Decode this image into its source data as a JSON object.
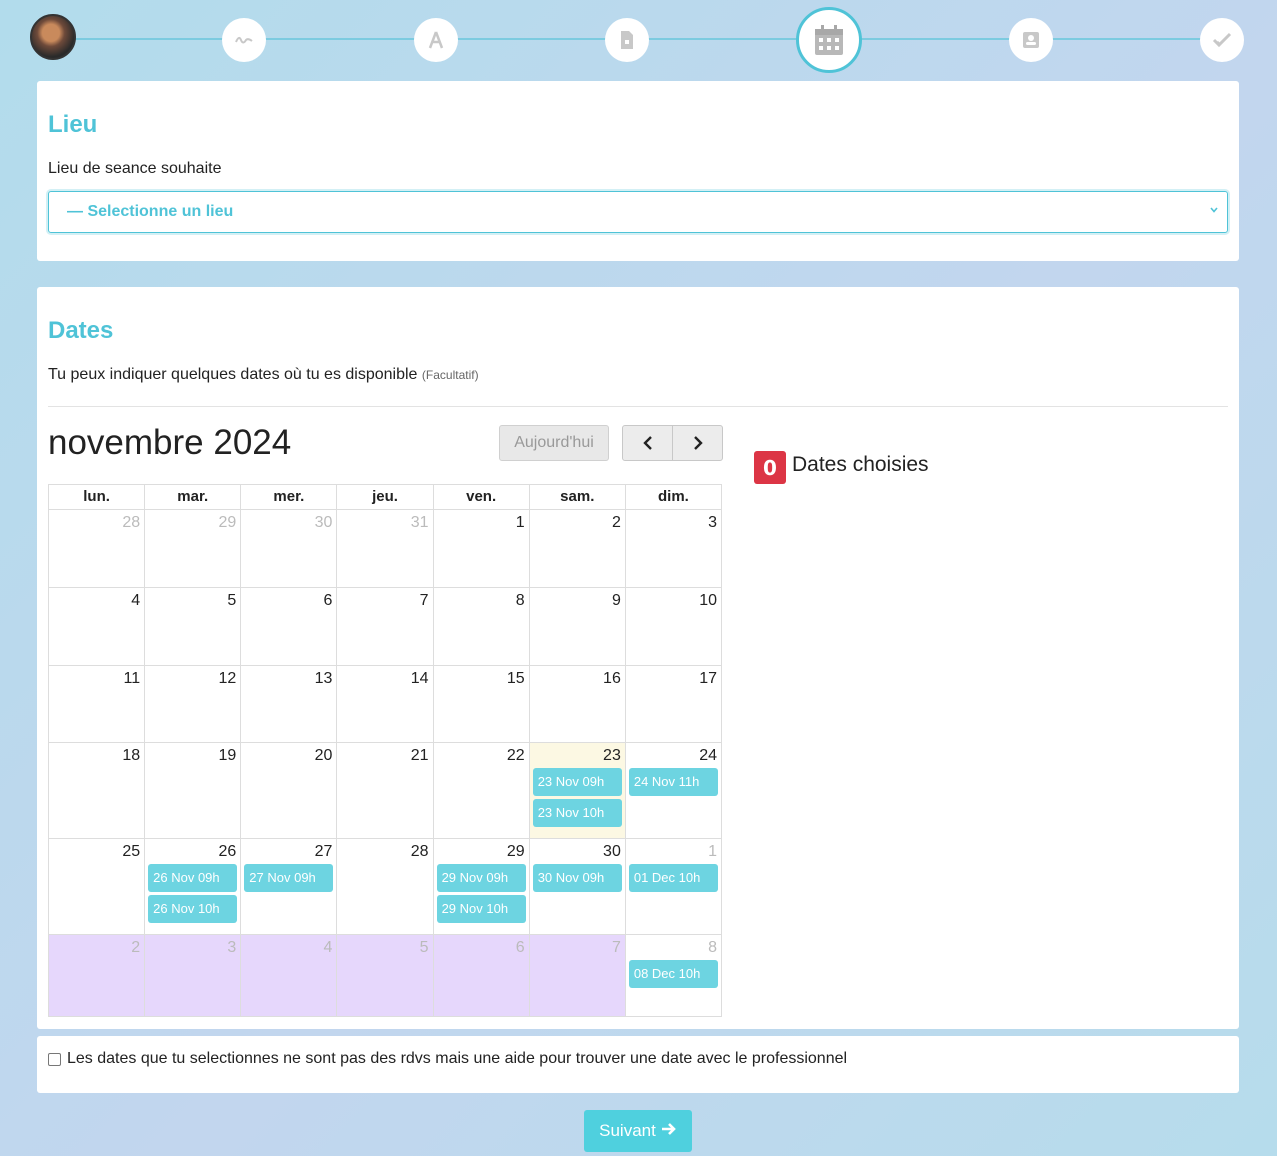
{
  "stepper": {
    "steps": [
      {
        "icon": "avatar"
      },
      {
        "icon": "signature-icon"
      },
      {
        "icon": "compass-icon"
      },
      {
        "icon": "document-icon"
      },
      {
        "icon": "calendar-icon",
        "active": true
      },
      {
        "icon": "contact-card-icon"
      },
      {
        "icon": "check-icon"
      }
    ]
  },
  "lieu": {
    "title": "Lieu",
    "label": "Lieu de seance souhaite",
    "select_value": "— Selectionne un lieu"
  },
  "dates": {
    "title": "Dates",
    "subtitle": "Tu peux indiquer quelques dates où tu es disponible",
    "optional": "(Facultatif)",
    "month_title": "novembre 2024",
    "today_button": "Aujourd'hui",
    "prev_label": "‹",
    "next_label": "›",
    "count": "0",
    "count_label": "Dates choisies",
    "weekdays": [
      "lun.",
      "mar.",
      "mer.",
      "jeu.",
      "ven.",
      "sam.",
      "dim."
    ],
    "weeks": [
      [
        {
          "d": "28",
          "o": true
        },
        {
          "d": "29",
          "o": true
        },
        {
          "d": "30",
          "o": true
        },
        {
          "d": "31",
          "o": true
        },
        {
          "d": "1"
        },
        {
          "d": "2"
        },
        {
          "d": "3"
        }
      ],
      [
        {
          "d": "4"
        },
        {
          "d": "5"
        },
        {
          "d": "6"
        },
        {
          "d": "7"
        },
        {
          "d": "8"
        },
        {
          "d": "9"
        },
        {
          "d": "10"
        }
      ],
      [
        {
          "d": "11"
        },
        {
          "d": "12"
        },
        {
          "d": "13"
        },
        {
          "d": "14"
        },
        {
          "d": "15"
        },
        {
          "d": "16"
        },
        {
          "d": "17"
        }
      ],
      [
        {
          "d": "18"
        },
        {
          "d": "19"
        },
        {
          "d": "20"
        },
        {
          "d": "21"
        },
        {
          "d": "22"
        },
        {
          "d": "23",
          "today": true,
          "events": [
            "23 Nov 09h",
            "23 Nov 10h"
          ]
        },
        {
          "d": "24",
          "events": [
            "24 Nov 11h"
          ]
        }
      ],
      [
        {
          "d": "25"
        },
        {
          "d": "26",
          "events": [
            "26 Nov 09h",
            "26 Nov 10h"
          ]
        },
        {
          "d": "27",
          "events": [
            "27 Nov 09h"
          ]
        },
        {
          "d": "28"
        },
        {
          "d": "29",
          "events": [
            "29 Nov 09h",
            "29 Nov 10h"
          ]
        },
        {
          "d": "30",
          "events": [
            "30 Nov 09h"
          ]
        },
        {
          "d": "1",
          "o": true,
          "events": [
            "01 Dec 10h"
          ]
        }
      ],
      [
        {
          "d": "2",
          "o": true,
          "purple": true
        },
        {
          "d": "3",
          "o": true,
          "purple": true
        },
        {
          "d": "4",
          "o": true,
          "purple": true
        },
        {
          "d": "5",
          "o": true,
          "purple": true
        },
        {
          "d": "6",
          "o": true,
          "purple": true
        },
        {
          "d": "7",
          "o": true,
          "purple": true
        },
        {
          "d": "8",
          "o": true,
          "events": [
            "08 Dec 10h"
          ]
        }
      ]
    ]
  },
  "notice": {
    "checked": false,
    "text": "Les dates que tu selectionnes ne sont pas des rdvs mais une aide pour trouver une date avec le professionnel"
  },
  "footer": {
    "next_button": "Suivant"
  },
  "colors": {
    "accent": "#4fc3d7",
    "event": "#6dd4e1",
    "badge": "#dc3545",
    "today_bg": "#fcf8e3",
    "disabled_bg": "#e6d7fc"
  }
}
